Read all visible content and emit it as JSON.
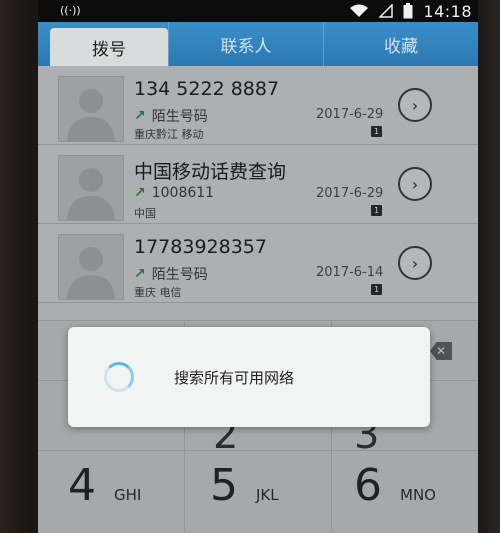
{
  "status": {
    "signal_label": "((·))",
    "time": "14:18"
  },
  "tabs": [
    {
      "label": "拨号",
      "active": true
    },
    {
      "label": "联系人",
      "active": false
    },
    {
      "label": "收藏",
      "active": false
    }
  ],
  "calls": [
    {
      "name": "134 5222 8887",
      "sub": "陌生号码",
      "location": "重庆黔江 移动",
      "date": "2017-6-29",
      "sim": "1"
    },
    {
      "name": "中国移动话费查询",
      "sub": "1008611",
      "location": "中国",
      "date": "2017-6-29",
      "sim": "1"
    },
    {
      "name": "17783928357",
      "sub": "陌生号码",
      "location": "重庆 电信",
      "date": "2017-6-14",
      "sim": "1"
    }
  ],
  "dialpad": {
    "row2": [
      {
        "num": "4",
        "letters": "GHI"
      },
      {
        "num": "5",
        "letters": "JKL"
      },
      {
        "num": "6",
        "letters": "MNO"
      }
    ],
    "partial": [
      "2",
      "3"
    ]
  },
  "dialog": {
    "message": "搜索所有可用网络"
  }
}
